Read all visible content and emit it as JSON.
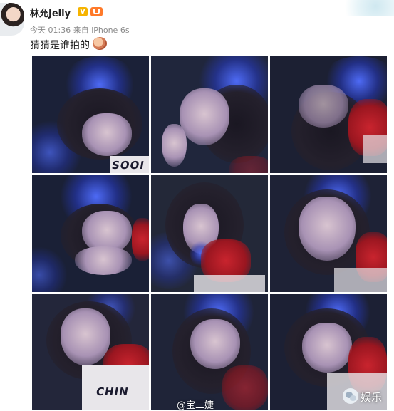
{
  "post": {
    "username": "林允Jelly",
    "vip_badge": "V",
    "time": "今天 01:36",
    "source": "来自 iPhone 6s",
    "text": "猜猜是谁拍的"
  },
  "photos": [
    {
      "shirt_text": "SOOI"
    },
    {
      "shirt_text": ""
    },
    {
      "shirt_text": ""
    },
    {
      "shirt_text": ""
    },
    {
      "shirt_text": ""
    },
    {
      "shirt_text": ""
    },
    {
      "shirt_text": "CHIN"
    },
    {
      "shirt_text": ""
    },
    {
      "shirt_text": ""
    }
  ],
  "watermark": {
    "name": "@宝二婕",
    "brand": "娱乐"
  },
  "icons": [
    "avatar",
    "vip-badge-icon",
    "member-badge-icon",
    "emoji-icon",
    "wechat-icon"
  ],
  "colors": {
    "username": "#222222",
    "meta": "#8a8a8a",
    "photo_glow": "#506eff",
    "vip": "#f6b400"
  }
}
